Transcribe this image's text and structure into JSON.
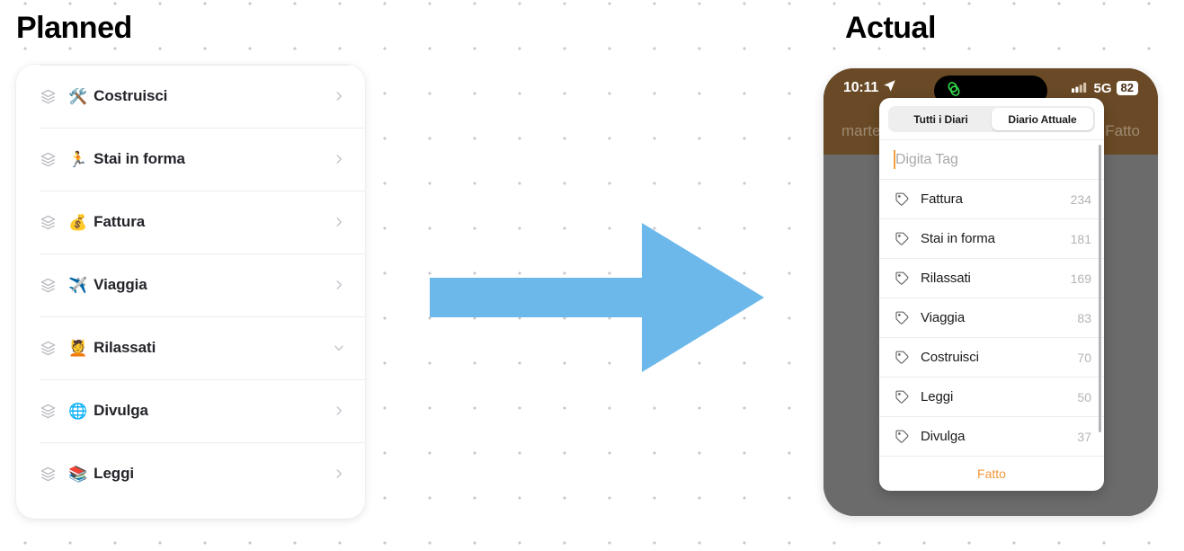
{
  "panels": {
    "left_title": "Planned",
    "right_title": "Actual"
  },
  "colors": {
    "arrow": "#6cb8ea",
    "navbar_brown": "#6a4a26",
    "dim_gray": "#6b6b6b",
    "accent_orange": "#f1983a",
    "dot_grid": "#c9c9cd"
  },
  "planned_list": {
    "items": [
      {
        "emoji": "🛠️",
        "label": "Costruisci",
        "chevron": "chevron-right-icon"
      },
      {
        "emoji": "🏃",
        "label": "Stai in forma",
        "chevron": "chevron-right-icon"
      },
      {
        "emoji": "💰",
        "label": "Fattura",
        "chevron": "chevron-right-icon"
      },
      {
        "emoji": "✈️",
        "label": "Viaggia",
        "chevron": "chevron-right-icon"
      },
      {
        "emoji": "💆",
        "label": "Rilassati",
        "chevron": "chevron-down-icon"
      },
      {
        "emoji": "🌐",
        "label": "Divulga",
        "chevron": "chevron-right-icon"
      },
      {
        "emoji": "📚",
        "label": "Leggi",
        "chevron": "chevron-right-icon"
      }
    ]
  },
  "arrow": {
    "icon": "arrow-right-icon",
    "direction": "right"
  },
  "phone": {
    "status_bar": {
      "time": "10:11",
      "location_icon": "location-arrow-icon",
      "island_icon": "link-loop-icon",
      "signal_icon": "cellular-bars-icon",
      "network": "5G",
      "battery_level": "82"
    },
    "navbar": {
      "date_label": "marted",
      "done_label": "Fatto"
    },
    "popover": {
      "segments": [
        {
          "label": "Tutti i Diari",
          "selected": false
        },
        {
          "label": "Diario Attuale",
          "selected": true
        }
      ],
      "tag_input_placeholder": "Digita Tag",
      "tag_input_value": "",
      "tags": [
        {
          "name": "Fattura",
          "count": "234"
        },
        {
          "name": "Stai in forma",
          "count": "181"
        },
        {
          "name": "Rilassati",
          "count": "169"
        },
        {
          "name": "Viaggia",
          "count": "83"
        },
        {
          "name": "Costruisci",
          "count": "70"
        },
        {
          "name": "Leggi",
          "count": "50"
        },
        {
          "name": "Divulga",
          "count": "37"
        }
      ],
      "done_label": "Fatto"
    }
  }
}
